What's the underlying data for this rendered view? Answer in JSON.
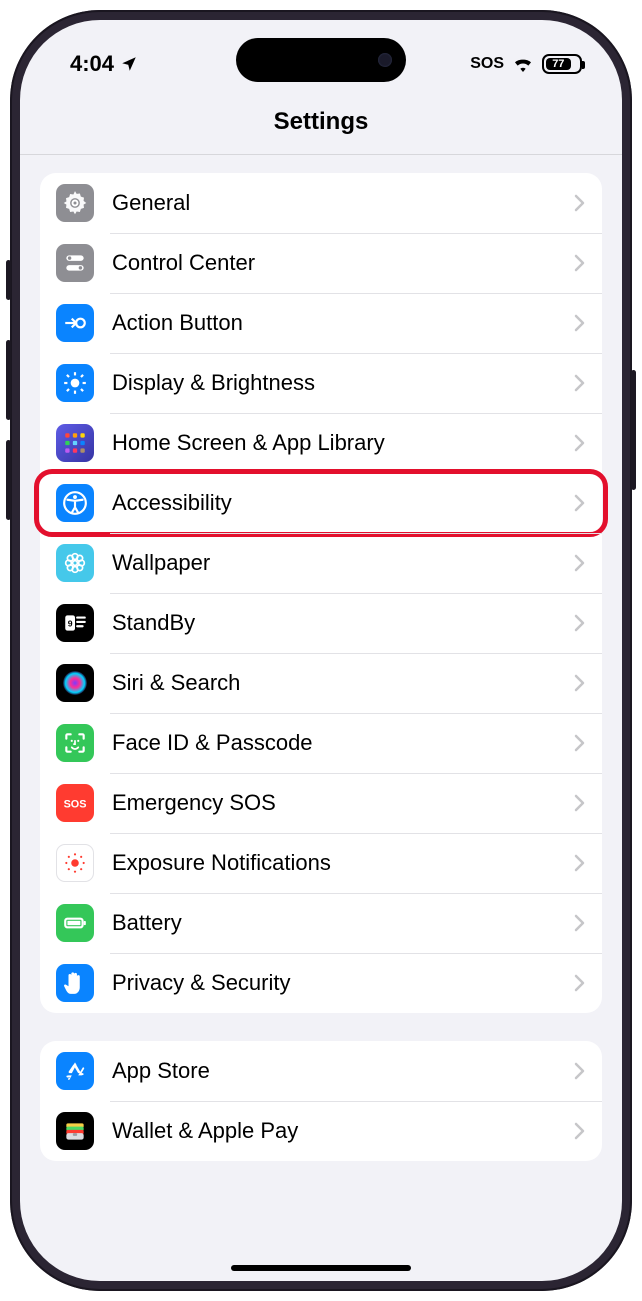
{
  "status": {
    "time": "4:04",
    "sos": "SOS",
    "battery_pct": "77",
    "battery_fill_pct": 77
  },
  "header": {
    "title": "Settings"
  },
  "groups": [
    {
      "rows": [
        {
          "key": "general",
          "label": "General",
          "icon": "gear",
          "bg": "#8e8e93"
        },
        {
          "key": "control-center",
          "label": "Control Center",
          "icon": "toggles",
          "bg": "#8e8e93"
        },
        {
          "key": "action-button",
          "label": "Action Button",
          "icon": "action",
          "bg": "#0a84ff"
        },
        {
          "key": "display",
          "label": "Display & Brightness",
          "icon": "sun",
          "bg": "#0a84ff"
        },
        {
          "key": "home-screen",
          "label": "Home Screen & App Library",
          "icon": "grid",
          "bg": "indigo"
        },
        {
          "key": "accessibility",
          "label": "Accessibility",
          "icon": "accessibility",
          "bg": "#0a84ff",
          "highlight": true
        },
        {
          "key": "wallpaper",
          "label": "Wallpaper",
          "icon": "flower",
          "bg": "#45c8ea"
        },
        {
          "key": "standby",
          "label": "StandBy",
          "icon": "standby",
          "bg": "#000000"
        },
        {
          "key": "siri",
          "label": "Siri & Search",
          "icon": "siri",
          "bg": "#000000"
        },
        {
          "key": "faceid",
          "label": "Face ID & Passcode",
          "icon": "faceid",
          "bg": "#34c759"
        },
        {
          "key": "sos",
          "label": "Emergency SOS",
          "icon": "sos",
          "bg": "#ff3b30"
        },
        {
          "key": "exposure",
          "label": "Exposure Notifications",
          "icon": "exposure",
          "bg": "#ffffff"
        },
        {
          "key": "battery",
          "label": "Battery",
          "icon": "battery",
          "bg": "#34c759"
        },
        {
          "key": "privacy",
          "label": "Privacy & Security",
          "icon": "hand",
          "bg": "#0a84ff"
        }
      ]
    },
    {
      "rows": [
        {
          "key": "app-store",
          "label": "App Store",
          "icon": "appstore",
          "bg": "#0a84ff"
        },
        {
          "key": "wallet",
          "label": "Wallet & Apple Pay",
          "icon": "wallet",
          "bg": "#000000"
        }
      ]
    }
  ]
}
